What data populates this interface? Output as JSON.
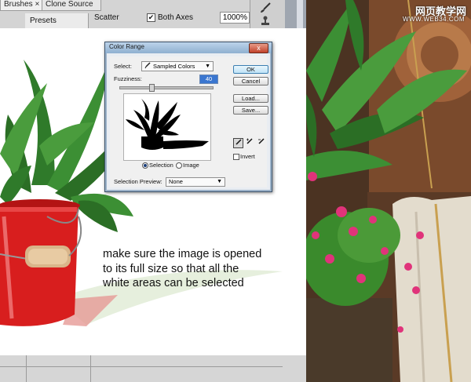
{
  "panel": {
    "tabs": [
      {
        "label": "Brushes ×"
      },
      {
        "label": "Clone Source"
      }
    ],
    "presets_label": "Presets",
    "scatter_label": "Scatter",
    "both_axes_label": "Both Axes",
    "both_axes_checked": "✔",
    "scatter_value": "1000%"
  },
  "tools": {
    "brush_icon": "brush-icon",
    "stamp_icon": "clone-stamp-icon"
  },
  "dialog": {
    "title": "Color Range",
    "close_glyph": "x",
    "select_label": "Select:",
    "select_value": "Sampled Colors",
    "fuzziness_label": "Fuzziness:",
    "fuzziness_value": "40",
    "radio_selection": "Selection",
    "radio_image": "Image",
    "selection_preview_label": "Selection Preview:",
    "selection_preview_value": "None",
    "buttons": {
      "ok": "OK",
      "cancel": "Cancel",
      "load": "Load...",
      "save": "Save..."
    },
    "invert_label": "Invert",
    "fuzziness_fraction": 0.33
  },
  "instruction": {
    "line1": "make sure the image is opened",
    "line2": "to its full size so that all the",
    "line3": "white areas can be selected"
  },
  "watermark": {
    "site_cn": "网页教学网",
    "url": "WWW.WEB34.COM"
  }
}
